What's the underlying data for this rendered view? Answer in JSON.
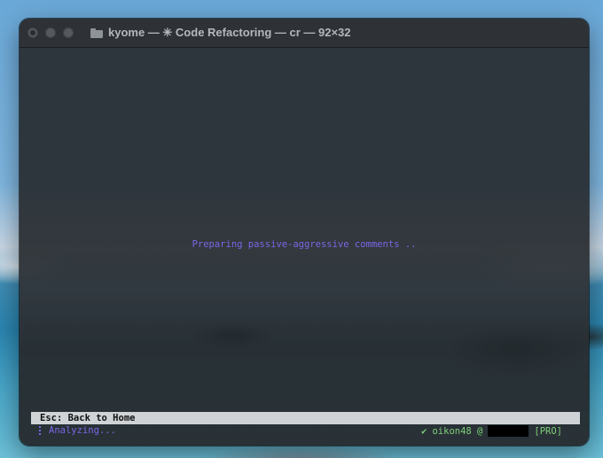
{
  "window": {
    "title": "kyome — ✳ Code Refactoring — cr — 92×32"
  },
  "terminal": {
    "center_message": "Preparing passive-aggressive comments ..",
    "hint_bar": "Esc: Back to Home",
    "status_left": "Analyzing...",
    "status_right_user": "oikon48 @",
    "status_right_plan": "[PRO]"
  },
  "icons": {
    "folder": "folder-icon",
    "spinner": "spinner-icon",
    "check": "check-icon"
  },
  "colors": {
    "accent_purple": "#7b66e6",
    "status_green": "#7ed07a",
    "hint_bar_bg": "#cfd3d6"
  }
}
